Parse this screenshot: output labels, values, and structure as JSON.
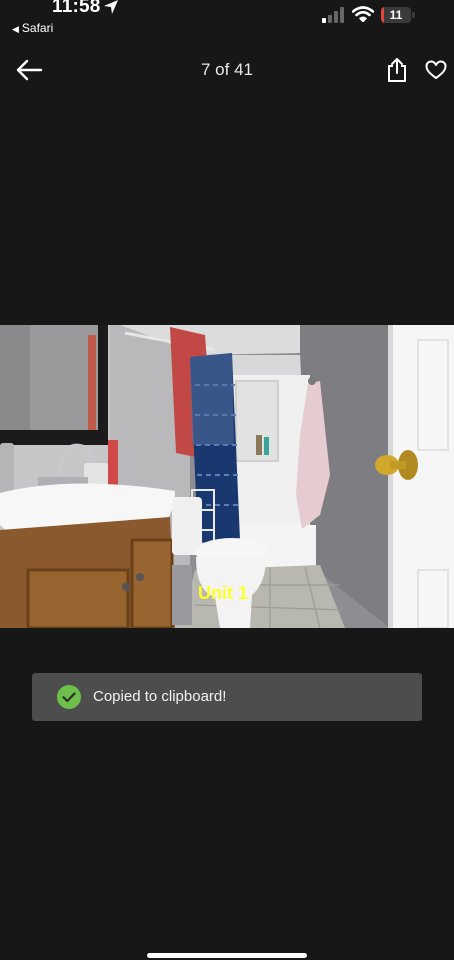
{
  "status_bar": {
    "time": "11:58",
    "back_app": "Safari",
    "battery_level": "11",
    "battery_fraction": 0.11,
    "battery_color": "#e0463c",
    "icons": [
      "location-arrow-icon",
      "cellular-signal-icon",
      "wifi-icon",
      "battery-icon"
    ]
  },
  "nav": {
    "counter": "7 of 41",
    "icons": [
      "back-arrow-icon",
      "share-icon",
      "heart-icon"
    ]
  },
  "photo": {
    "overlay_label": "Unit 1",
    "overlay_color": "#ffff2a"
  },
  "toast": {
    "message": "Copied to clipboard!",
    "icon": "check-circle-icon",
    "icon_color": "#6cc04a"
  }
}
